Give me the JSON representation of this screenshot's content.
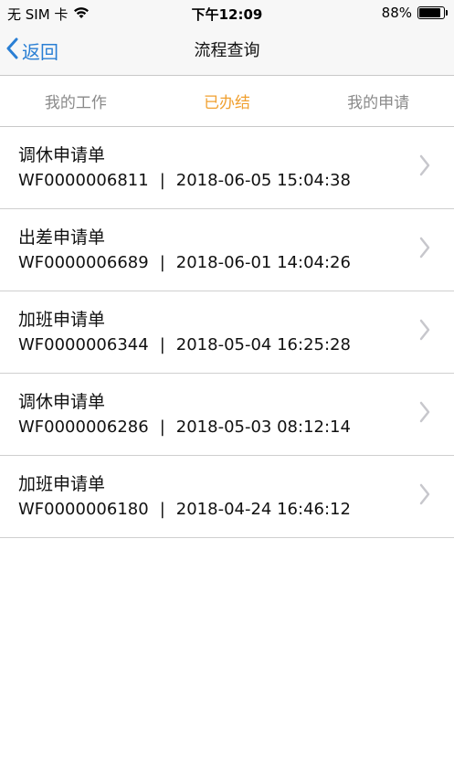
{
  "statusbar": {
    "carrier": "无 SIM 卡",
    "time": "下午12:09",
    "battery_text": "88%",
    "battery_level": 0.88
  },
  "navbar": {
    "back_label": "返回",
    "title": "流程查询"
  },
  "tabs": [
    {
      "label": "我的工作",
      "active": false
    },
    {
      "label": "已办结",
      "active": true
    },
    {
      "label": "我的申请",
      "active": false
    }
  ],
  "items": [
    {
      "title": "调休申请单",
      "id": "WF0000006811",
      "sep": "|",
      "datetime": "2018-06-05 15:04:38"
    },
    {
      "title": "出差申请单",
      "id": "WF0000006689",
      "sep": "|",
      "datetime": "2018-06-01 14:04:26"
    },
    {
      "title": "加班申请单",
      "id": "WF0000006344",
      "sep": "|",
      "datetime": "2018-05-04 16:25:28"
    },
    {
      "title": "调休申请单",
      "id": "WF0000006286",
      "sep": "|",
      "datetime": "2018-05-03 08:12:14"
    },
    {
      "title": "加班申请单",
      "id": "WF0000006180",
      "sep": "|",
      "datetime": "2018-04-24 16:46:12"
    }
  ],
  "colors": {
    "accent_blue": "#2a7fd4",
    "active_tab": "#f0a030",
    "inactive_tab": "#8a8a8a"
  }
}
